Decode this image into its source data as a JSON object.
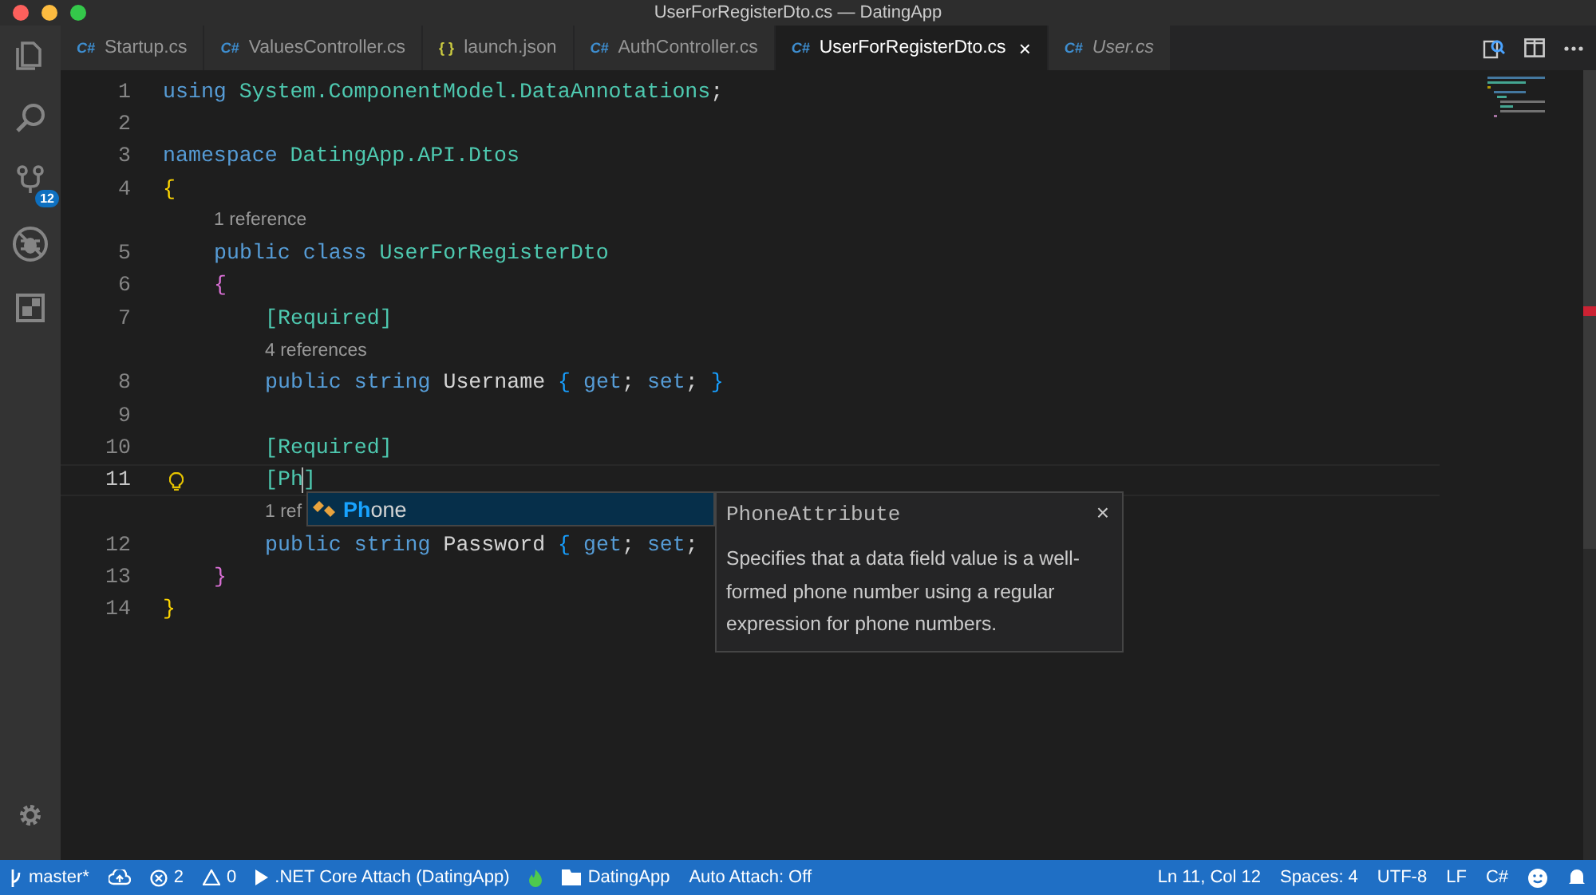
{
  "window": {
    "title": "UserForRegisterDto.cs — DatingApp"
  },
  "activity_bar": {
    "items": [
      {
        "kind": "files"
      },
      {
        "kind": "search"
      },
      {
        "kind": "scm",
        "badge": "12"
      },
      {
        "kind": "debug"
      },
      {
        "kind": "extensions"
      }
    ]
  },
  "tabs": [
    {
      "label": "Startup.cs",
      "icon_text": "C#",
      "kind": "csharp",
      "selected": false,
      "preview": false
    },
    {
      "label": "ValuesController.cs",
      "icon_text": "C#",
      "kind": "csharp",
      "selected": false,
      "preview": false
    },
    {
      "label": "launch.json",
      "icon_text": "{ }",
      "kind": "json",
      "selected": false,
      "preview": false
    },
    {
      "label": "AuthController.cs",
      "icon_text": "C#",
      "kind": "csharp",
      "selected": false,
      "preview": false
    },
    {
      "label": "UserForRegisterDto.cs",
      "icon_text": "C#",
      "kind": "csharp",
      "selected": true,
      "preview": false,
      "close": "×"
    },
    {
      "label": "User.cs",
      "icon_text": "C#",
      "kind": "csharp",
      "selected": false,
      "preview": true
    }
  ],
  "editor": {
    "lines": [
      {
        "kind": "code",
        "number": "1",
        "tokens": [
          {
            "text": "using ",
            "kind": "keyword"
          },
          {
            "text": "System.ComponentModel.DataAnnotations",
            "kind": "type"
          },
          {
            "text": ";",
            "kind": "plain"
          }
        ]
      },
      {
        "kind": "code",
        "number": "2"
      },
      {
        "kind": "code",
        "number": "3",
        "tokens": [
          {
            "text": "namespace ",
            "kind": "keyword"
          },
          {
            "text": "DatingApp.API.Dtos",
            "kind": "type"
          }
        ]
      },
      {
        "kind": "code",
        "number": "4",
        "tokens": [
          {
            "text": "{",
            "kind": "brace1"
          }
        ],
        "children": [
          {
            "kind": "codelens",
            "text": "1 reference"
          },
          {
            "kind": "code",
            "number": "5",
            "tokens": [
              {
                "text": "public ",
                "kind": "keyword"
              },
              {
                "text": "class ",
                "kind": "keyword"
              },
              {
                "text": "UserForRegisterDto",
                "kind": "type"
              }
            ]
          },
          {
            "kind": "code",
            "number": "6",
            "tokens": [
              {
                "text": "{",
                "kind": "brace2"
              }
            ],
            "children": [
              {
                "kind": "code",
                "number": "7",
                "tokens": [
                  {
                    "text": "[Required]",
                    "kind": "attribute"
                  }
                ]
              },
              {
                "kind": "codelens",
                "text": "4 references"
              },
              {
                "kind": "code",
                "number": "8",
                "tokens": [
                  {
                    "text": "public ",
                    "kind": "keyword"
                  },
                  {
                    "text": "string ",
                    "kind": "keyword"
                  },
                  {
                    "text": "Username ",
                    "kind": "plain"
                  },
                  {
                    "text": "{ ",
                    "kind": "brace3"
                  },
                  {
                    "text": "get",
                    "kind": "keyword"
                  },
                  {
                    "text": "; ",
                    "kind": "plain"
                  },
                  {
                    "text": "set",
                    "kind": "keyword"
                  },
                  {
                    "text": "; ",
                    "kind": "plain"
                  },
                  {
                    "text": "}",
                    "kind": "brace3"
                  }
                ]
              },
              {
                "kind": "code",
                "number": "9"
              },
              {
                "kind": "code",
                "number": "10",
                "tokens": [
                  {
                    "text": "[Required]",
                    "kind": "attribute"
                  }
                ]
              },
              {
                "kind": "code",
                "number": "11",
                "active": true,
                "lightbulb": true,
                "tokens": [
                  {
                    "text": "[Ph]",
                    "kind": "attribute"
                  }
                ]
              },
              {
                "kind": "codelens",
                "text": "1 ref"
              },
              {
                "kind": "code",
                "number": "12",
                "tokens": [
                  {
                    "text": "public ",
                    "kind": "keyword"
                  },
                  {
                    "text": "string ",
                    "kind": "keyword"
                  },
                  {
                    "text": "Password ",
                    "kind": "plain"
                  },
                  {
                    "text": "{ ",
                    "kind": "brace3"
                  },
                  {
                    "text": "get",
                    "kind": "keyword"
                  },
                  {
                    "text": "; ",
                    "kind": "plain"
                  },
                  {
                    "text": "set",
                    "kind": "keyword"
                  },
                  {
                    "text": ";",
                    "kind": "plain"
                  }
                ]
              }
            ]
          },
          {
            "kind": "code",
            "number": "13",
            "tokens": [
              {
                "text": "}",
                "kind": "brace2"
              }
            ]
          }
        ]
      },
      {
        "kind": "code",
        "number": "14",
        "tokens": [
          {
            "text": "}",
            "kind": "brace1"
          }
        ]
      }
    ]
  },
  "suggest": {
    "items": [
      {
        "match": "Ph",
        "rest": "one",
        "selected": true
      }
    ],
    "details": {
      "title": "PhoneAttribute",
      "close": "×",
      "description": "Specifies that a data field value is a well-formed phone number using a regular expression for phone numbers."
    }
  },
  "status_bar": {
    "left": [
      {
        "kind": "branch",
        "text": "master*"
      },
      {
        "kind": "sync"
      },
      {
        "kind": "errors",
        "text": "2"
      },
      {
        "kind": "warnings",
        "text": "0"
      },
      {
        "kind": "play",
        "text": ".NET Core Attach (DatingApp)"
      },
      {
        "kind": "flame"
      },
      {
        "kind": "folder",
        "text": "DatingApp"
      },
      {
        "kind": "plain",
        "text": "Auto Attach: Off"
      }
    ],
    "right": [
      {
        "kind": "plain",
        "text": "Ln 11, Col 12"
      },
      {
        "kind": "plain",
        "text": "Spaces: 4"
      },
      {
        "kind": "plain",
        "text": "UTF-8"
      },
      {
        "kind": "plain",
        "text": "LF"
      },
      {
        "kind": "plain",
        "text": "C#"
      },
      {
        "kind": "smiley"
      },
      {
        "kind": "bell"
      }
    ]
  }
}
